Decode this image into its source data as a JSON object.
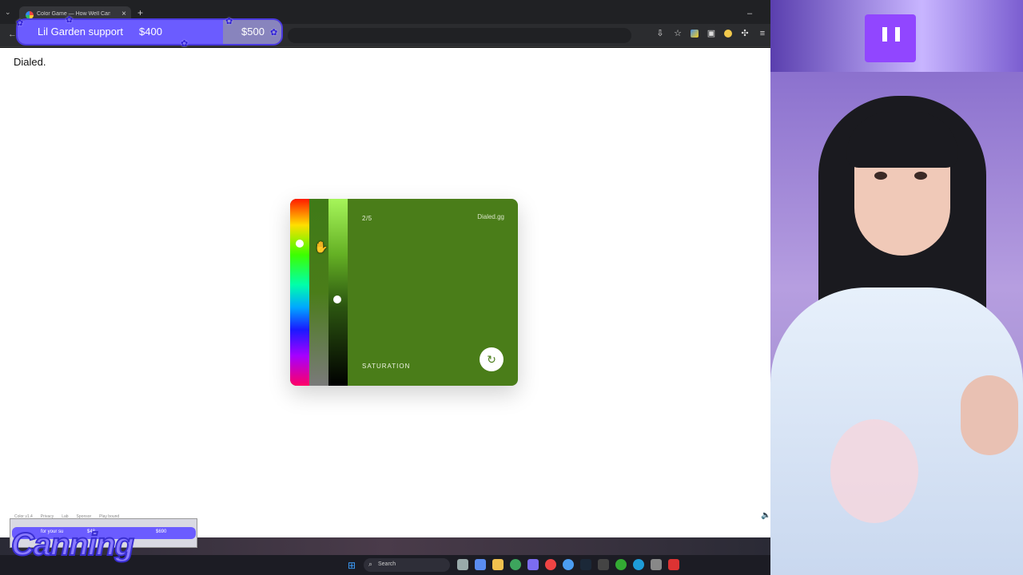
{
  "browser": {
    "tab_title": "Color Game — How Well Can You",
    "close_glyph": "×",
    "new_tab_glyph": "+",
    "minimize_glyph": "–",
    "back_glyph": "←",
    "tab_menu_glyph": "⌄"
  },
  "toolbar_icons": [
    "install-icon",
    "star-icon",
    "extension-icon",
    "extension-icon",
    "extension-icon",
    "puzzle-icon",
    "menu-icon"
  ],
  "donation_goal": {
    "label": "Lil Garden support",
    "current": "$400",
    "target": "$500",
    "progress": 0.8
  },
  "page": {
    "brand": "Dialed.",
    "round": "2/5",
    "site": "Dialed.gg",
    "step_label": "SATURATION",
    "submit_glyph": "↻",
    "swatch_color": "#4a7d19",
    "footer": [
      "Color v1.4",
      "Privacy",
      "Lab",
      "Sponsor",
      "Play bound"
    ]
  },
  "mini_goal": {
    "label": "for your su",
    "current": "$48",
    "target": "$690"
  },
  "streamer_logo": "Canning",
  "taskbar": {
    "search_placeholder": "Search",
    "search_glyph": "⌕",
    "windows_glyph": "⊞"
  }
}
